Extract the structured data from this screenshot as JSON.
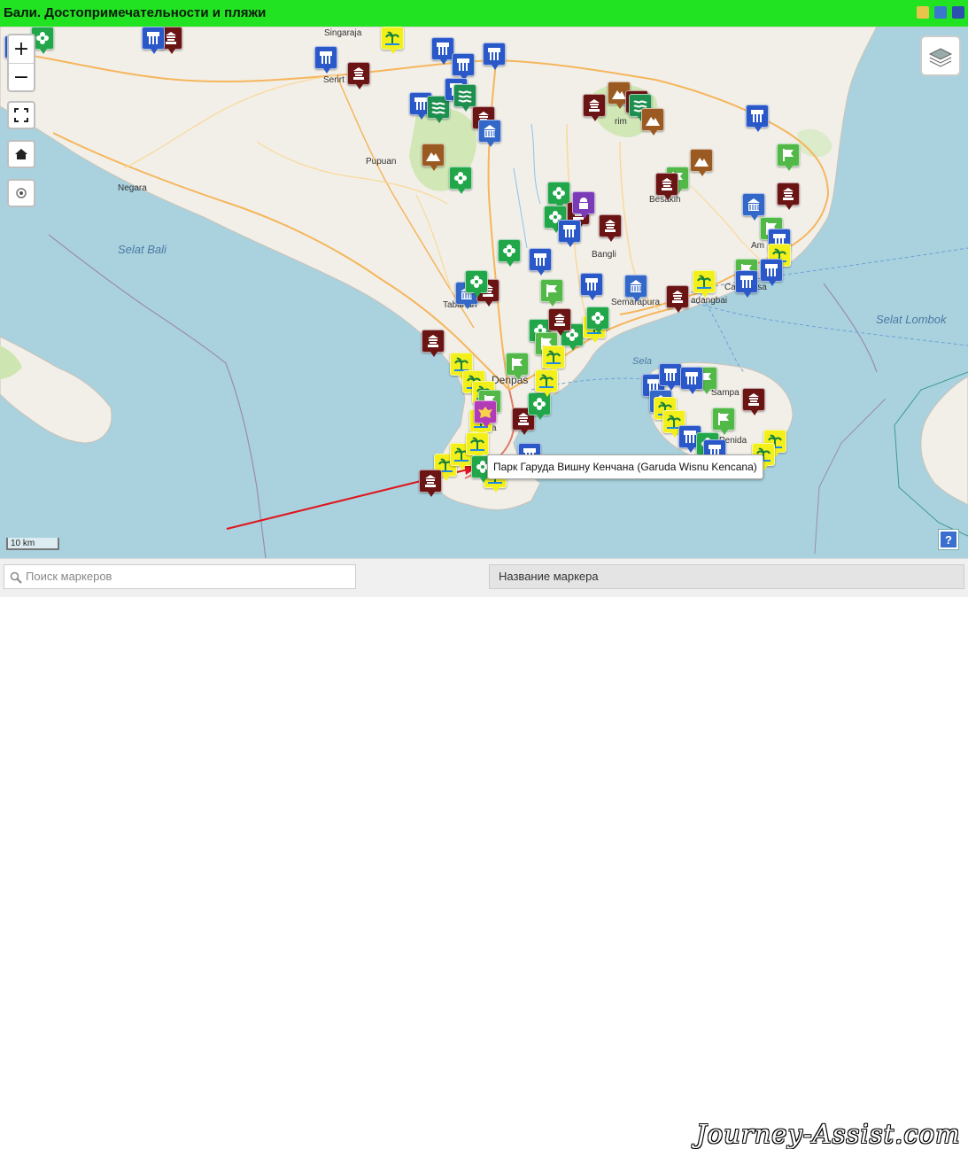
{
  "header": {
    "title": "Бали. Достопримечательности и пляжи"
  },
  "map": {
    "zoom_in": "+",
    "zoom_out": "−",
    "scale_label": "10 km",
    "help_label": "?",
    "place_labels": {
      "singaraja": "Singaraja",
      "seririt": "Serirt",
      "pupuan": "Pupuan",
      "negara": "Negara",
      "tabanan": "Tabanan",
      "bangli": "Bangli",
      "semarapura": "Semarapura",
      "besakih": "Besakih",
      "denpasar": "Denpas",
      "kuta": "Kuta",
      "sampa": "Sampa",
      "penida": "Penida",
      "rim": "rim",
      "candidasa": "Candidasa",
      "padangbai": "adangbai",
      "amlapura": "Am"
    },
    "sea_labels": {
      "selat_bali": "Selat Bali",
      "selat_lombok": "Selat Lombok",
      "selat_badung": "Sela"
    },
    "tooltip": "Парк Гаруда Вишну Кенчана (Garuda Wisnu Kencana)",
    "colors": {
      "temple": "#6b1414",
      "waterfall": "#2a58c8",
      "beach": "#f2ef1a",
      "flower": "#22a64a",
      "flag": "#52b848",
      "volcano": "#9a5a22",
      "building": "#3468c8",
      "water_green": "#1d8f4e"
    }
  },
  "footer": {
    "search_placeholder": "Поиск маркеров",
    "marker_name_placeholder": "Название маркера",
    "watermark": "Journey-Assist.com"
  }
}
